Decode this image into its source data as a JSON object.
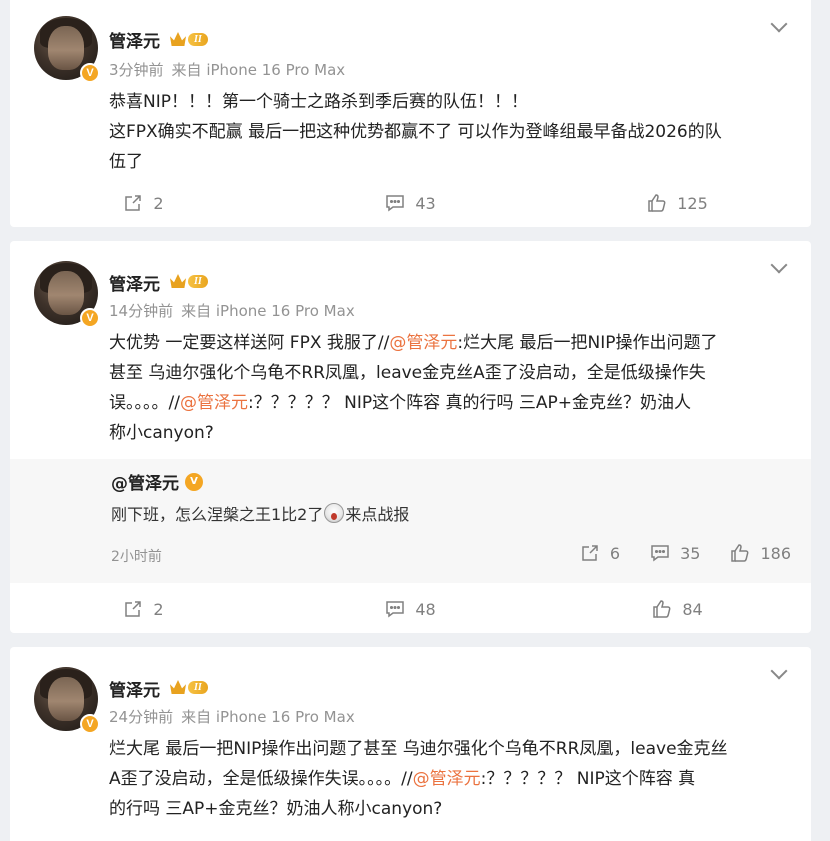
{
  "posts": [
    {
      "author": "管泽元",
      "level": "II",
      "time": "3分钟前",
      "source": "来自 iPhone 16 Pro Max",
      "lines": [
        "恭喜NIP！！！第一个骑士之路杀到季后赛的队伍！！！",
        "这FPX确实不配赢 最后一把这种优势都赢不了 可以作为登峰组最早备战2026的队",
        "伍了"
      ],
      "repost_count": "2",
      "comment_count": "43",
      "like_count": "125"
    },
    {
      "author": "管泽元",
      "level": "II",
      "time": "14分钟前",
      "source": "来自 iPhone 16 Pro Max",
      "line1_a": "大优势 一定要这样送阿 FPX 我服了//",
      "line1_at": "@管泽元",
      "line1_b": ":烂大尾 最后一把NIP操作出问题了",
      "line2": "甚至 乌迪尔强化个乌龟不RR凤凰，leave金克丝A歪了没启动，全是低级操作失",
      "line3_a": "误。。。。//",
      "line3_at": "@管泽元",
      "line3_b": ":？？？？？ NIP这个阵容 真的行吗 三AP+金克丝？奶油人",
      "line4": "称小canyon?",
      "repost": {
        "name": "@管泽元",
        "text_a": "刚下班，怎么涅槃之王1比2了",
        "text_b": "来点战报",
        "time": "2小时前",
        "repost_count": "6",
        "comment_count": "35",
        "like_count": "186"
      },
      "repost_count": "2",
      "comment_count": "48",
      "like_count": "84"
    },
    {
      "author": "管泽元",
      "level": "II",
      "time": "24分钟前",
      "source": "来自 iPhone 16 Pro Max",
      "line1": "烂大尾 最后一把NIP操作出问题了甚至 乌迪尔强化个乌龟不RR凤凰，leave金克丝",
      "line2_a": "A歪了没启动，全是低级操作失误。。。。//",
      "line2_at": "@管泽元",
      "line2_b": ":？？？？？ NIP这个阵容 真",
      "line3": "的行吗 三AP+金克丝？奶油人称小canyon?"
    }
  ],
  "verified_badge": "V",
  "icons": [
    "repost-icon",
    "comment-icon",
    "like-icon",
    "chevron-down-icon",
    "verified-icon",
    "crown-icon",
    "shocked-emoji-icon"
  ],
  "colors": {
    "mention": "#eb7340",
    "badge": "#f4a623",
    "muted": "#939393"
  }
}
